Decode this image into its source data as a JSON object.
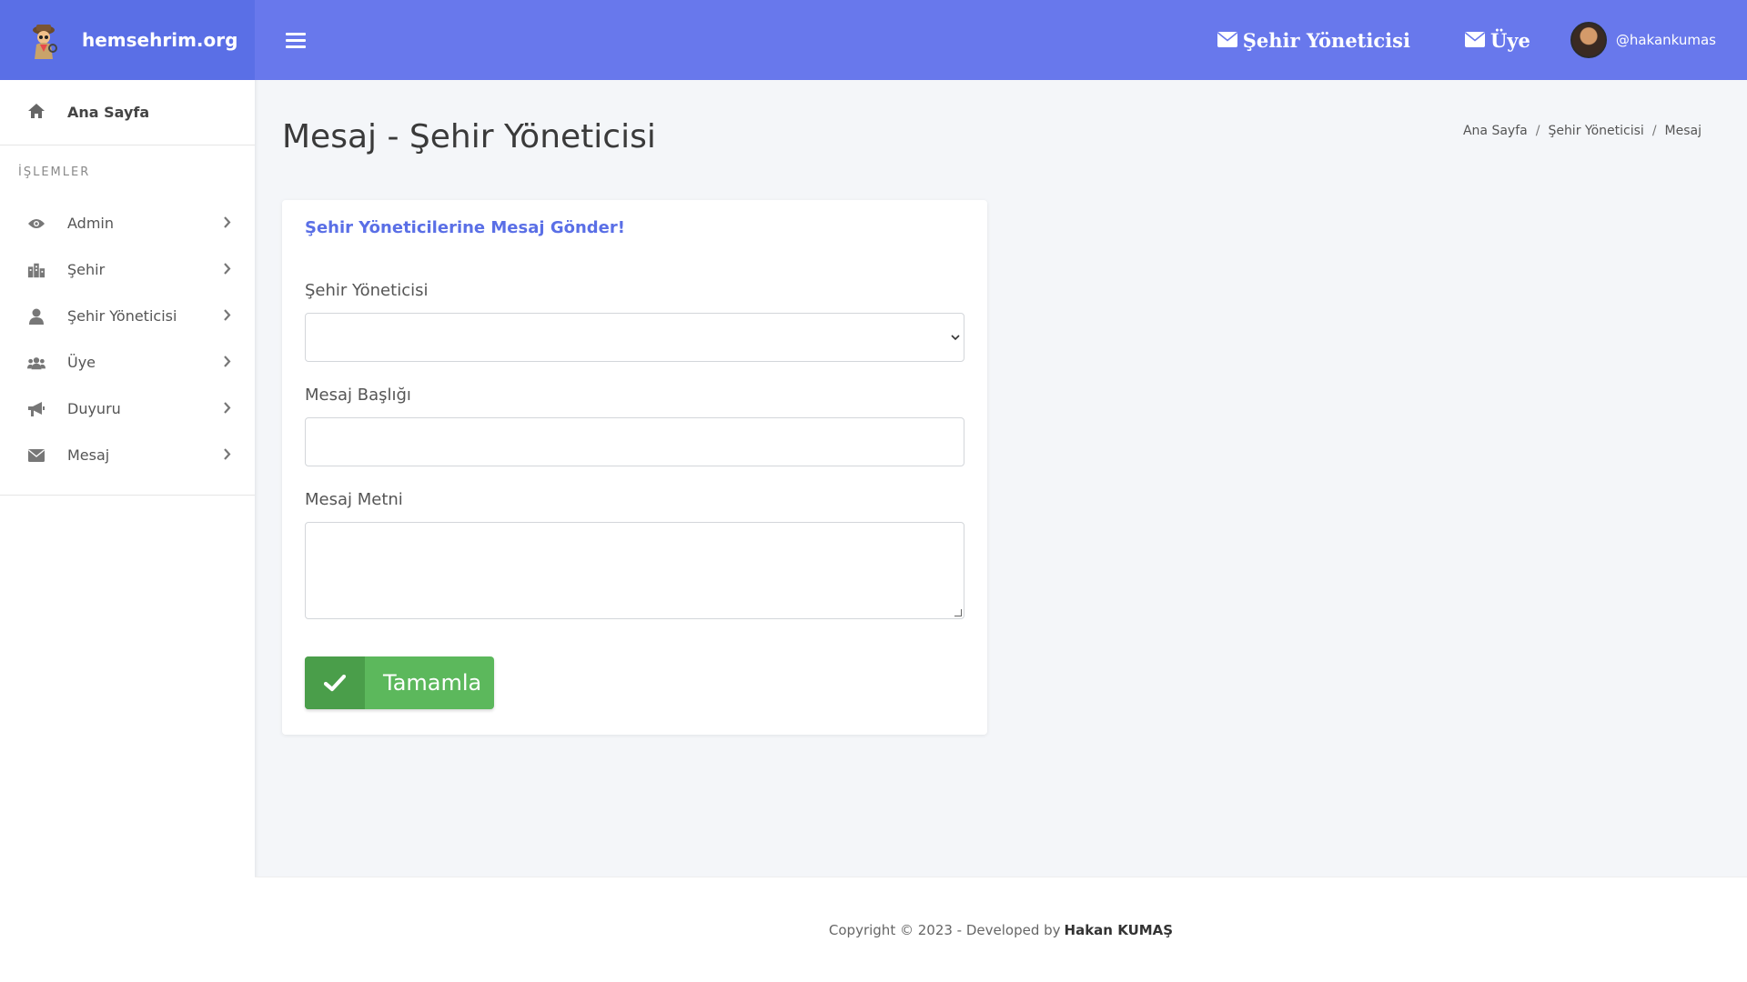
{
  "brand": {
    "name": "hemsehrim.org",
    "logo_icon": "detective-mascot-icon"
  },
  "sidebar": {
    "home_label": "Ana Sayfa",
    "section_title": "İŞLEMLER",
    "items": [
      {
        "label": "Admin",
        "icon": "eye-icon"
      },
      {
        "label": "Şehir",
        "icon": "city-icon"
      },
      {
        "label": "Şehir Yöneticisi",
        "icon": "user-icon"
      },
      {
        "label": "Üye",
        "icon": "users-icon"
      },
      {
        "label": "Duyuru",
        "icon": "megaphone-icon"
      },
      {
        "label": "Mesaj",
        "icon": "envelope-icon"
      }
    ]
  },
  "header": {
    "links": [
      {
        "label": "Şehir Yöneticisi",
        "icon": "envelope-icon"
      },
      {
        "label": "Üye",
        "icon": "envelope-icon"
      }
    ],
    "username": "@hakankumas"
  },
  "page": {
    "title": "Mesaj - Şehir Yöneticisi",
    "breadcrumb": [
      "Ana Sayfa",
      "Şehir Yöneticisi",
      "Mesaj"
    ]
  },
  "form": {
    "title": "Şehir Yöneticilerine Mesaj Gönder!",
    "manager_label": "Şehir Yöneticisi",
    "manager_value": "",
    "subject_label": "Mesaj Başlığı",
    "subject_value": "",
    "body_label": "Mesaj Metni",
    "body_value": "",
    "submit_label": "Tamamla"
  },
  "footer": {
    "copyright": "Copyright © 2023 - Developed by",
    "developer": "Hakan KUMAŞ"
  },
  "colors": {
    "brand": "#5a6fe6",
    "header": "#6878ec",
    "success": "#5cb85c",
    "success_dark": "#4a9e4a"
  }
}
